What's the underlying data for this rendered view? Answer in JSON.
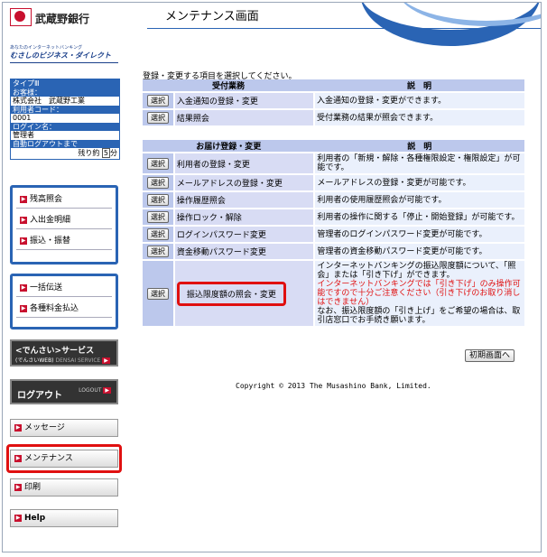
{
  "header": {
    "bank_name": "武蔵野銀行",
    "page_title": "メンテナンス画面"
  },
  "brand": {
    "line_small": "あなたのインターネットバンキング",
    "line_main": "むさしのビジネス・ダイレクト"
  },
  "info": {
    "type_label": "タイプⅢ",
    "customer_label": "お客様：",
    "customer_value": "株式会社　武蔵野工業",
    "user_code_label": "利用者コード：",
    "user_code_value": "0001",
    "login_label": "ログイン名：",
    "login_value": "管理者",
    "auto_logout_label": "自動ログアウトまで",
    "remaining_prefix": "残り約",
    "remaining_value": "5",
    "remaining_unit": "分"
  },
  "nav": {
    "group1": [
      "残高照会",
      "入出金明細",
      "振込・振替"
    ],
    "group2": [
      "一括伝送",
      "各種料金払込"
    ],
    "densai_title": "<でんさい>サービス",
    "densai_sub": "(でんさいWEB)",
    "densai_sub2": "DENSAI SERVICE",
    "logout": "ログアウト",
    "logout_en": "LOGOUT",
    "message": "メッセージ",
    "maintenance": "メンテナンス",
    "print": "印刷",
    "help": "Help"
  },
  "main": {
    "intro": "登録・変更する項目を選択してください。",
    "select_label": "選択",
    "table1": {
      "header_left": "受付業務",
      "header_right": "説　明",
      "rows": [
        {
          "name": "入金通知の登録・変更",
          "desc": "入金通知の登録・変更ができます。"
        },
        {
          "name": "結果照会",
          "desc": "受付業務の結果が照会できます。"
        }
      ]
    },
    "table2": {
      "header_left": "お届け登録・変更",
      "header_right": "説　明",
      "rows": [
        {
          "name": "利用者の登録・変更",
          "desc": "利用者の「新規・解除・各種権限設定・権限設定」が可能です。"
        },
        {
          "name": "メールアドレスの登録・変更",
          "desc": "メールアドレスの登録・変更が可能です。"
        },
        {
          "name": "操作履歴照会",
          "desc": "利用者の使用履歴照会が可能です。"
        },
        {
          "name": "操作ロック・解除",
          "desc": "利用者の操作に関する「停止・開始登録」が可能です。"
        },
        {
          "name": "ログインパスワード変更",
          "desc": "管理者のログインパスワード変更が可能です。"
        },
        {
          "name": "資金移動パスワード変更",
          "desc": "管理者の資金移動パスワード変更が可能です。"
        }
      ],
      "limit_row": {
        "name": "振込限度額の照会・変更",
        "desc1": "インターネットバンキングの振込限度額について、「照会」または「引き下げ」ができます。",
        "desc2": "インターネットバンキングでは「引き下げ」のみ操作可能ですので十分ご注意ください（引き下げのお取り消しはできません）",
        "desc3": "なお、振込限度額の「引き上げ」をご希望の場合は、取引店窓口でお手続き願います。"
      }
    },
    "init_button": "初期画面へ",
    "copyright": "Copyright © 2013 The Musashino Bank, Limited."
  },
  "colors": {
    "brand_blue": "#2a64b4",
    "highlight_red": "#e01010"
  }
}
